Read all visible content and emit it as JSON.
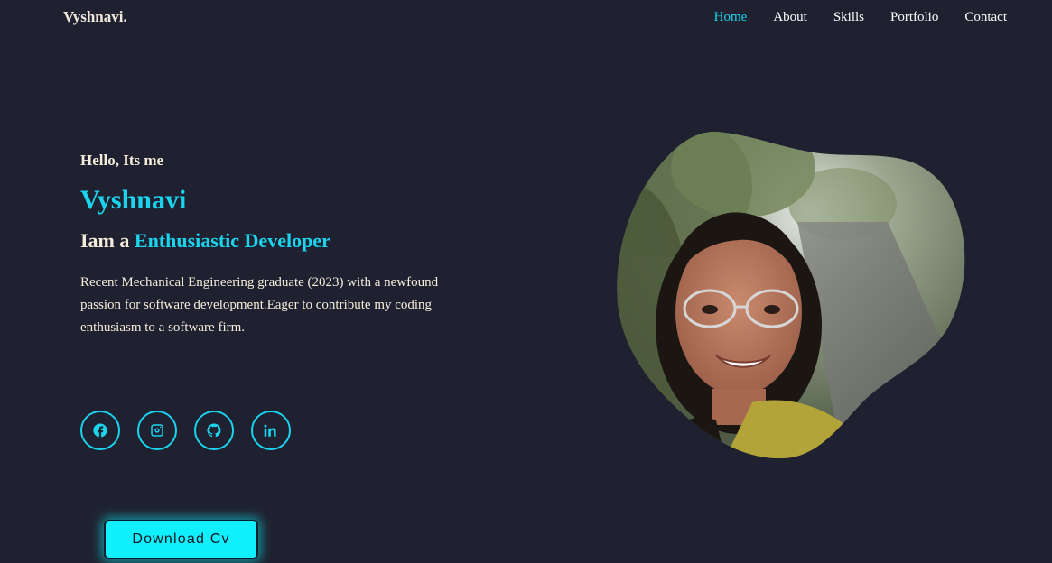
{
  "header": {
    "logo": "Vyshnavi.",
    "nav": [
      {
        "label": "Home",
        "active": true
      },
      {
        "label": "About"
      },
      {
        "label": "Skills"
      },
      {
        "label": "Portfolio"
      },
      {
        "label": "Contact"
      }
    ]
  },
  "hero": {
    "greeting": "Hello, Its me",
    "name": "Vyshnavi",
    "role_prefix": "Iam a",
    "role_highlight": "Enthusiastic Developer",
    "description": "Recent Mechanical Engineering graduate (2023) with a newfound passion for software development.Eager to contribute my coding enthusiasm to a software firm."
  },
  "socials": [
    {
      "icon": "facebook-icon"
    },
    {
      "icon": "instagram-icon"
    },
    {
      "icon": "github-icon"
    },
    {
      "icon": "linkedin-icon"
    }
  ],
  "cv_button": {
    "label": "Download Cv"
  },
  "colors": {
    "background": "#1f2130",
    "accent": "#19d4ec",
    "button": "#0ff0fc",
    "text": "#f5eddc"
  }
}
